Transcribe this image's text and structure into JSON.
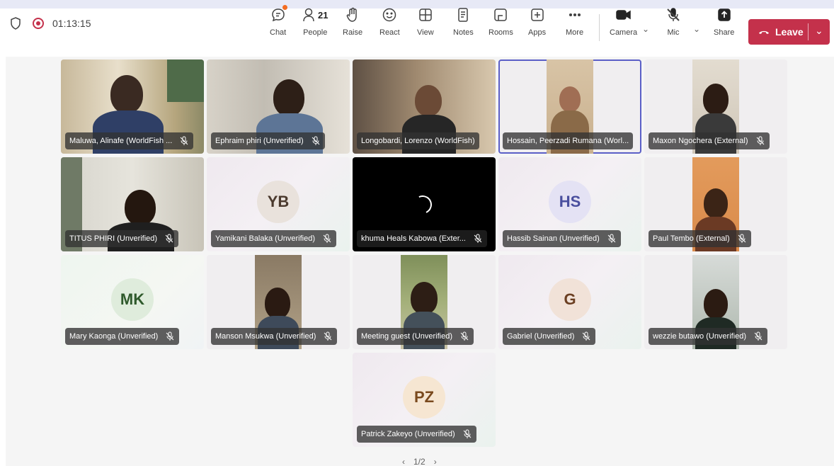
{
  "meeting": {
    "timer": "01:13:15"
  },
  "toolbar": {
    "chat": "Chat",
    "people": "People",
    "people_count": "21",
    "raise": "Raise",
    "react": "React",
    "view": "View",
    "notes": "Notes",
    "rooms": "Rooms",
    "apps": "Apps",
    "more": "More",
    "camera": "Camera",
    "mic": "Mic",
    "share": "Share",
    "leave": "Leave"
  },
  "participants": [
    {
      "name": "Maluwa, Alinafe (WorldFish ...",
      "type": "video"
    },
    {
      "name": "Ephraim phiri (Unverified)",
      "type": "video"
    },
    {
      "name": "Longobardi, Lorenzo (WorldFish)",
      "type": "video"
    },
    {
      "name": "Hossain, Peerzadi Rumana (Worl...",
      "type": "video",
      "selected": true
    },
    {
      "name": "Maxon Ngochera (External)",
      "type": "video"
    },
    {
      "name": "TITUS PHIRI (Unverified)",
      "type": "video"
    },
    {
      "name": "Yamikani Balaka (Unverified)",
      "type": "avatar",
      "initials": "YB"
    },
    {
      "name": "khuma Heals Kabowa (Exter...",
      "type": "loading"
    },
    {
      "name": "Hassib Sainan (Unverified)",
      "type": "avatar",
      "initials": "HS"
    },
    {
      "name": "Paul Tembo (External)",
      "type": "video"
    },
    {
      "name": "Mary Kaonga (Unverified)",
      "type": "avatar",
      "initials": "MK"
    },
    {
      "name": "Manson Msukwa (Unverified)",
      "type": "video"
    },
    {
      "name": "Meeting guest (Unverified)",
      "type": "video"
    },
    {
      "name": "Gabriel (Unverified)",
      "type": "avatar",
      "initials": "G"
    },
    {
      "name": "wezzie butawo (Unverified)",
      "type": "video"
    },
    {
      "name": "Patrick Zakeyo (Unverified)",
      "type": "avatar",
      "initials": "PZ"
    }
  ],
  "pager": {
    "label": "1/2"
  },
  "colors": {
    "leave": "#c4314b",
    "selected_outline": "#5b5fc7",
    "recording": "#c4314b"
  },
  "icons": [
    "shield-icon",
    "record-icon",
    "chat-icon",
    "people-icon",
    "raise-hand-icon",
    "react-icon",
    "view-icon",
    "notes-icon",
    "rooms-icon",
    "apps-icon",
    "more-icon",
    "camera-icon",
    "mic-off-icon",
    "share-icon",
    "phone-icon"
  ]
}
